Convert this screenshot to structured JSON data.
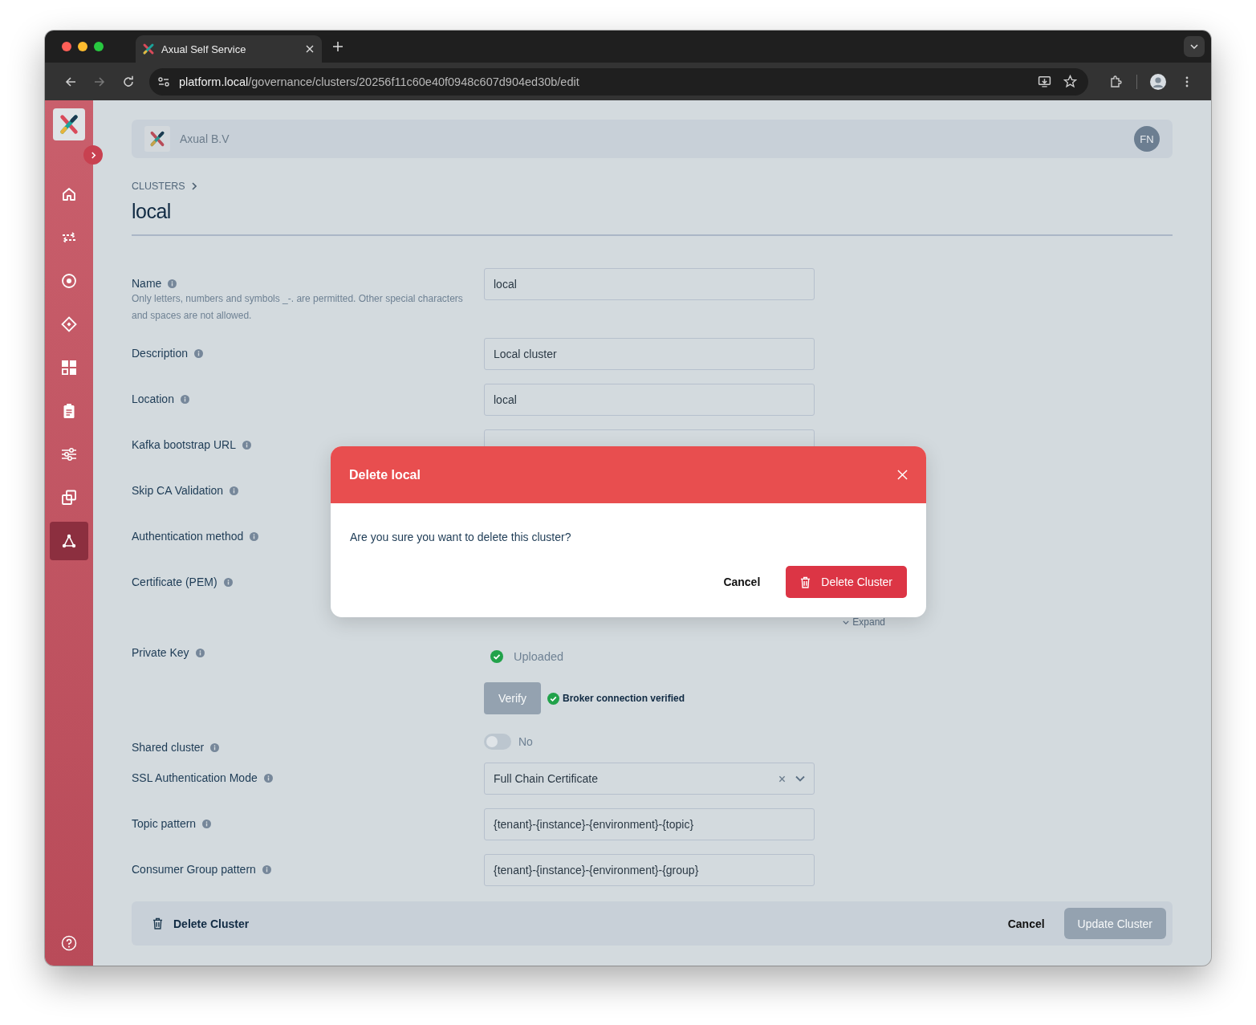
{
  "browser": {
    "tab_title": "Axual Self Service",
    "url_host": "platform.local",
    "url_path": "/governance/clusters/20256f11c60e40f0948c607d904ed30b/edit"
  },
  "sidebar": {
    "items": [
      {
        "kind": "home",
        "selected": false
      },
      {
        "kind": "transfer",
        "selected": false
      },
      {
        "kind": "target",
        "selected": false
      },
      {
        "kind": "diamond",
        "selected": false
      },
      {
        "kind": "grid",
        "selected": false
      },
      {
        "kind": "clipboard",
        "selected": false
      },
      {
        "kind": "sliders",
        "selected": false
      },
      {
        "kind": "copy",
        "selected": false
      },
      {
        "kind": "network",
        "selected": true
      }
    ]
  },
  "header": {
    "organization": "Axual B.V",
    "avatar": "FN"
  },
  "breadcrumb": [
    "CLUSTERS"
  ],
  "title": "local",
  "form": {
    "fields": [
      {
        "kind": "input",
        "label": "Name",
        "hint": "Only letters, numbers and symbols _-. are permitted. Other special characters and spaces are not allowed.",
        "value": "local"
      },
      {
        "kind": "input",
        "label": "Description",
        "value": "Local cluster"
      },
      {
        "kind": "input",
        "label": "Location",
        "value": "local"
      },
      {
        "kind": "covered-input",
        "label": "Kafka bootstrap URL"
      },
      {
        "kind": "covered",
        "label": "Skip CA Validation"
      },
      {
        "kind": "covered",
        "label": "Authentication method"
      },
      {
        "kind": "covered-expand",
        "label": "Certificate (PEM)",
        "link": "Expand"
      },
      {
        "kind": "status",
        "label": "Private Key",
        "status": "Uploaded"
      },
      {
        "kind": "verify",
        "button": "Verify",
        "disabled": true,
        "message": "Broker connection verified"
      },
      {
        "kind": "toggle",
        "label": "Shared cluster",
        "on": false,
        "text": "No"
      },
      {
        "kind": "select",
        "label": "SSL Authentication Mode",
        "value": "Full Chain Certificate"
      },
      {
        "kind": "input",
        "label": "Topic pattern",
        "value": "{tenant}-{instance}-{environment}-{topic}"
      },
      {
        "kind": "input",
        "label": "Consumer Group pattern",
        "value": "{tenant}-{instance}-{environment}-{group}"
      }
    ]
  },
  "footer": {
    "delete": "Delete Cluster",
    "cancel": "Cancel",
    "submit": "Update Cluster",
    "submit_disabled": true
  },
  "modal": {
    "title": "Delete local",
    "message": "Are you sure you want to delete this cluster?",
    "cancel": "Cancel",
    "confirm": "Delete Cluster"
  }
}
